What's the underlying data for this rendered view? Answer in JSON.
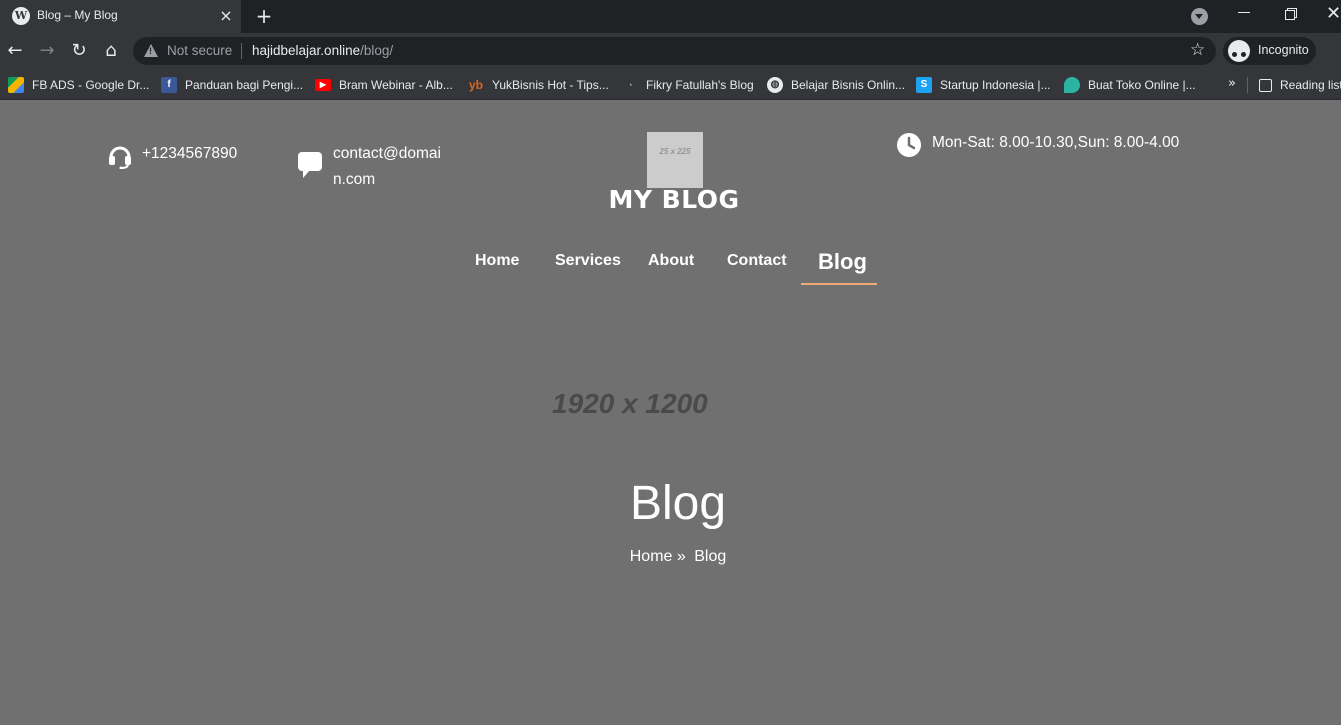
{
  "tab": {
    "title": "Blog – My Blog",
    "favicon": "wordpress-icon"
  },
  "window": {
    "minimize": "minimize-icon",
    "maximize": "restore-icon",
    "close": "close-icon"
  },
  "toolbar": {
    "security_text": "Not secure",
    "url_host": "hajidbelajar.online",
    "url_path": "/blog/",
    "profile_label": "Incognito"
  },
  "bookmarks": [
    {
      "label": "FB ADS - Google Dr...",
      "icon": "google-drive-icon",
      "color": "#f5b400"
    },
    {
      "label": "Panduan bagi Pengi...",
      "icon": "facebook-icon",
      "color": "#3b5998"
    },
    {
      "label": "Bram Webinar - Alb...",
      "icon": "youtube-icon",
      "color": "#ff0000"
    },
    {
      "label": "YukBisnis Hot - Tips...",
      "icon": "yb-icon",
      "color": "#e0661e"
    },
    {
      "label": "Fikry Fatullah's Blog",
      "icon": "blog-icon",
      "color": "#35363a"
    },
    {
      "label": "Belajar Bisnis Onlin...",
      "icon": "globe-icon",
      "color": "#e8eaed"
    },
    {
      "label": "Startup Indonesia |...",
      "icon": "startup-s-icon",
      "color": "#1da1f2"
    },
    {
      "label": "Buat Toko Online |...",
      "icon": "balloon-icon",
      "color": "#2bb3a3"
    }
  ],
  "bookmarks_overflow": "»",
  "reading_list": "Reading list",
  "header": {
    "phone": "+1234567890",
    "email_line1": "contact@domai",
    "email_line2": "n.com",
    "hours": "Mon-Sat: 8.00-10.30,Sun: 8.00-4.00",
    "logo_placeholder": "25 x 225",
    "site_title": "MY BLOG"
  },
  "nav": {
    "home": "Home",
    "services": "Services",
    "about": "About",
    "contact": "Contact",
    "blog": "Blog",
    "accent_color": "#f0a878"
  },
  "hero": {
    "image_placeholder": "1920 x 1200",
    "title": "Blog",
    "breadcrumb_home": "Home",
    "breadcrumb_sep": "»",
    "breadcrumb_current": "Blog"
  }
}
